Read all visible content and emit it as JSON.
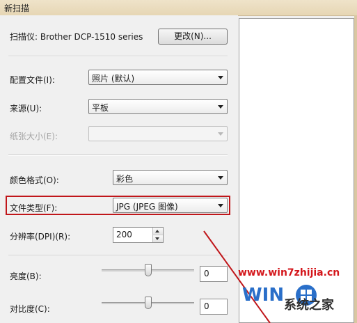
{
  "window": {
    "title": "新扫描"
  },
  "scanner": {
    "label": "扫描仪: Brother DCP-1510 series",
    "change_button": "更改(N)..."
  },
  "profile": {
    "label": "配置文件(I):",
    "value": "照片 (默认)"
  },
  "source": {
    "label": "来源(U):",
    "value": "平板"
  },
  "paper_size": {
    "label": "纸张大小(E):",
    "value": "",
    "disabled": true
  },
  "color_format": {
    "label": "颜色格式(O):",
    "value": "彩色"
  },
  "file_type": {
    "label": "文件类型(F):",
    "value": "JPG (JPEG 图像)",
    "highlight_color": "#c0161a"
  },
  "resolution": {
    "label": "分辨率(DPI)(R):",
    "value": "200"
  },
  "brightness": {
    "label": "亮度(B):",
    "value": "0",
    "slider_fraction": 0.5
  },
  "contrast": {
    "label": "对比度(C):",
    "value": "0",
    "slider_fraction": 0.5
  },
  "watermark": {
    "url": "www.win7zhijia.cn",
    "logo_letters": "WIN",
    "site_name": "系统之家",
    "color": "#d4161b"
  }
}
